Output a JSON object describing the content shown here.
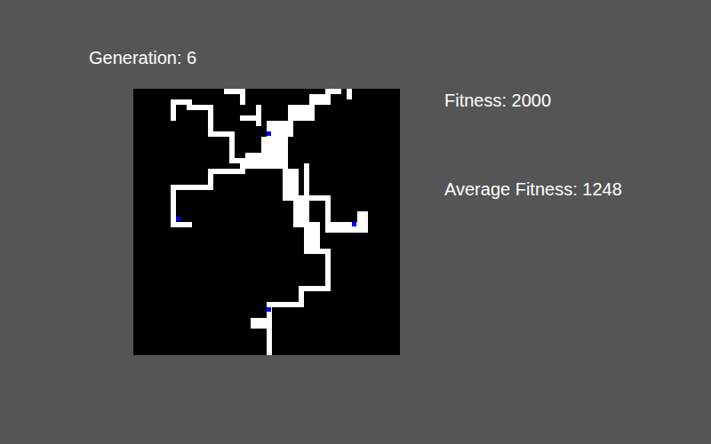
{
  "generation": {
    "label": "Generation: 6"
  },
  "stats": [
    {
      "label": "Fitness: 2000"
    },
    {
      "label": "Average Fitness: 1248"
    }
  ],
  "grid": {
    "cols": 50,
    "rows": 50,
    "cells": [
      {
        "col": 25,
        "row": 43,
        "w": 1,
        "h": 7
      },
      {
        "col": 22,
        "row": 43,
        "w": 4,
        "h": 2
      },
      {
        "col": 25,
        "row": 40,
        "w": 1,
        "h": 3
      },
      {
        "col": 25,
        "row": 40,
        "w": 7,
        "h": 1
      },
      {
        "col": 31,
        "row": 37,
        "w": 1,
        "h": 4
      },
      {
        "col": 31,
        "row": 37,
        "w": 6,
        "h": 1
      },
      {
        "col": 36,
        "row": 30,
        "w": 1,
        "h": 8
      },
      {
        "col": 33,
        "row": 30,
        "w": 4,
        "h": 1
      },
      {
        "col": 32,
        "row": 25,
        "w": 3,
        "h": 6
      },
      {
        "col": 30,
        "row": 20,
        "w": 3,
        "h": 6
      },
      {
        "col": 28,
        "row": 15,
        "w": 3,
        "h": 6
      },
      {
        "col": 24,
        "row": 9,
        "w": 5,
        "h": 6
      },
      {
        "col": 25,
        "row": 6,
        "w": 5,
        "h": 3
      },
      {
        "col": 29,
        "row": 3,
        "w": 5,
        "h": 3
      },
      {
        "col": 33,
        "row": 1,
        "w": 4,
        "h": 2
      },
      {
        "col": 36,
        "row": 0,
        "w": 3,
        "h": 1
      },
      {
        "col": 40,
        "row": 0,
        "w": 1,
        "h": 2
      },
      {
        "col": 17,
        "row": 0,
        "w": 4,
        "h": 1
      },
      {
        "col": 20,
        "row": 0,
        "w": 1,
        "h": 3
      },
      {
        "col": 20,
        "row": 5,
        "w": 4,
        "h": 1
      },
      {
        "col": 23,
        "row": 3,
        "w": 1,
        "h": 4
      },
      {
        "col": 7,
        "row": 2,
        "w": 4,
        "h": 1
      },
      {
        "col": 7,
        "row": 2,
        "w": 1,
        "h": 4
      },
      {
        "col": 10,
        "row": 3,
        "w": 4,
        "h": 1
      },
      {
        "col": 14,
        "row": 3,
        "w": 1,
        "h": 6
      },
      {
        "col": 14,
        "row": 8,
        "w": 5,
        "h": 1
      },
      {
        "col": 18,
        "row": 8,
        "w": 1,
        "h": 6
      },
      {
        "col": 18,
        "row": 13,
        "w": 8,
        "h": 1
      },
      {
        "col": 21,
        "row": 12,
        "w": 4,
        "h": 2
      },
      {
        "col": 20,
        "row": 14,
        "w": 5,
        "h": 1
      },
      {
        "col": 14,
        "row": 15,
        "w": 7,
        "h": 1
      },
      {
        "col": 14,
        "row": 15,
        "w": 1,
        "h": 4
      },
      {
        "col": 8,
        "row": 18,
        "w": 7,
        "h": 1
      },
      {
        "col": 7,
        "row": 18,
        "w": 1,
        "h": 8
      },
      {
        "col": 7,
        "row": 25,
        "w": 4,
        "h": 1
      },
      {
        "col": 32,
        "row": 14,
        "w": 1,
        "h": 7
      },
      {
        "col": 32,
        "row": 20,
        "w": 5,
        "h": 1
      },
      {
        "col": 36,
        "row": 20,
        "w": 1,
        "h": 6
      },
      {
        "col": 36,
        "row": 25,
        "w": 7,
        "h": 2
      },
      {
        "col": 42,
        "row": 23,
        "w": 2,
        "h": 4
      }
    ],
    "targets": [
      {
        "col": 25,
        "row": 8
      },
      {
        "col": 8,
        "row": 24
      },
      {
        "col": 41,
        "row": 25
      },
      {
        "col": 25,
        "row": 41
      }
    ]
  }
}
